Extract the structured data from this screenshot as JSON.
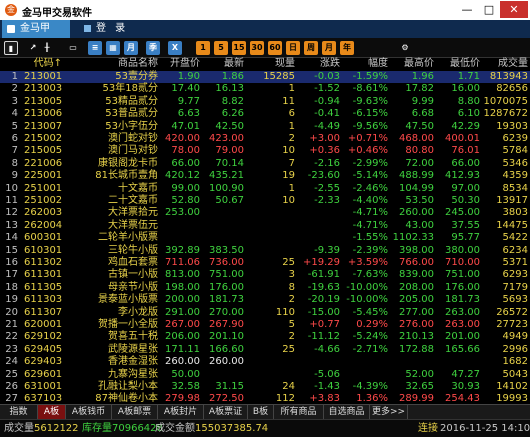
{
  "app": {
    "title": "金马甲交易软件",
    "icon": "金"
  },
  "window": {
    "min": "—",
    "max": "□",
    "close": "✕"
  },
  "tabs": {
    "active_label": "金马甲",
    "login_label": "登 录"
  },
  "toolbar": {
    "buttons": [
      {
        "name": "bar-chart-icon",
        "glyph": "▮",
        "style": "sel"
      },
      {
        "name": "line-chart-icon",
        "glyph": "↗",
        "style": "plain"
      },
      {
        "name": "kline-icon",
        "glyph": "╫",
        "style": "plain"
      },
      {
        "name": "window-icon",
        "glyph": "▭",
        "style": "plain"
      },
      {
        "name": "list-icon",
        "glyph": "≡",
        "style": "blue"
      },
      {
        "name": "table-icon",
        "glyph": "▦",
        "style": "blue"
      },
      {
        "name": "month-icon",
        "glyph": "月",
        "style": "blue"
      },
      {
        "name": "season-icon",
        "glyph": "季",
        "style": "blue"
      },
      {
        "name": "x-icon",
        "glyph": "X",
        "style": "blue"
      },
      {
        "name": "period-1-icon",
        "glyph": "1",
        "style": "orange"
      },
      {
        "name": "period-5-icon",
        "glyph": "5",
        "style": "orange"
      },
      {
        "name": "period-15-icon",
        "glyph": "15",
        "style": "orange"
      },
      {
        "name": "period-30-icon",
        "glyph": "30",
        "style": "orange"
      },
      {
        "name": "period-60-icon",
        "glyph": "60",
        "style": "orange"
      },
      {
        "name": "day-icon",
        "glyph": "日",
        "style": "orange"
      },
      {
        "name": "week-icon",
        "glyph": "周",
        "style": "orange"
      },
      {
        "name": "month2-icon",
        "glyph": "月",
        "style": "orange"
      },
      {
        "name": "year-icon",
        "glyph": "年",
        "style": "orange"
      },
      {
        "name": "gear-icon",
        "glyph": "⚙",
        "style": "plain"
      }
    ]
  },
  "columns": {
    "code": "代码↑",
    "name": "商品名称",
    "open": "开盘价",
    "last": "最新",
    "volume": "现量",
    "change": "涨跌",
    "pct": "幅度",
    "high": "最高价",
    "low": "最低价",
    "amount": "成交量"
  },
  "rows": [
    {
      "i": "1",
      "code": "213001",
      "name": "53壹分券",
      "open": "1.90",
      "last": "1.86",
      "vol": "15285",
      "chg": "-0.03",
      "pct": "-1.59%",
      "high": "1.96",
      "low": "1.71",
      "amt": "813943",
      "s": "dn",
      "sel": true
    },
    {
      "i": "2",
      "code": "213003",
      "name": "53年18贰分",
      "open": "17.40",
      "last": "16.13",
      "vol": "1",
      "chg": "-1.52",
      "pct": "-8.61%",
      "high": "17.82",
      "low": "16.00",
      "amt": "82656",
      "s": "dn"
    },
    {
      "i": "3",
      "code": "213005",
      "name": "53精品贰分",
      "open": "9.77",
      "last": "8.82",
      "vol": "11",
      "chg": "-0.94",
      "pct": "-9.63%",
      "high": "9.99",
      "low": "8.80",
      "amt": "1070075",
      "s": "dn"
    },
    {
      "i": "4",
      "code": "213006",
      "name": "53普品贰分",
      "open": "6.63",
      "last": "6.26",
      "vol": "6",
      "chg": "-0.41",
      "pct": "-6.15%",
      "high": "6.68",
      "low": "6.10",
      "amt": "1287672",
      "s": "dn"
    },
    {
      "i": "5",
      "code": "213007",
      "name": "53小字伍分",
      "open": "47.01",
      "last": "42.50",
      "vol": "1",
      "chg": "-4.49",
      "pct": "-9.56%",
      "high": "47.50",
      "low": "42.29",
      "amt": "19303",
      "s": "dn"
    },
    {
      "i": "6",
      "code": "215002",
      "name": "澳门蛇对钞",
      "open": "420.00",
      "last": "423.00",
      "vol": "2",
      "chg": "+3.00",
      "pct": "+0.71%",
      "high": "468.00",
      "low": "400.01",
      "amt": "6239",
      "s": "up"
    },
    {
      "i": "7",
      "code": "215005",
      "name": "澳门马对钞",
      "open": "78.00",
      "last": "79.00",
      "vol": "10",
      "chg": "+0.36",
      "pct": "+0.46%",
      "high": "80.80",
      "low": "76.01",
      "amt": "5784",
      "s": "up"
    },
    {
      "i": "8",
      "code": "221006",
      "name": "康银阁龙卡币",
      "open": "66.00",
      "last": "70.14",
      "vol": "7",
      "chg": "-2.16",
      "pct": "-2.99%",
      "high": "72.00",
      "low": "66.00",
      "amt": "5346",
      "s": "dn"
    },
    {
      "i": "9",
      "code": "225001",
      "name": "81长城币壹角",
      "open": "420.12",
      "last": "435.21",
      "vol": "19",
      "chg": "-23.60",
      "pct": "-5.14%",
      "high": "488.99",
      "low": "412.93",
      "amt": "4359",
      "s": "dn"
    },
    {
      "i": "10",
      "code": "251001",
      "name": "十文嘉币",
      "open": "99.00",
      "last": "100.90",
      "vol": "1",
      "chg": "-2.55",
      "pct": "-2.46%",
      "high": "104.99",
      "low": "97.00",
      "amt": "8534",
      "s": "dn"
    },
    {
      "i": "11",
      "code": "251002",
      "name": "二十文嘉币",
      "open": "52.80",
      "last": "50.67",
      "vol": "10",
      "chg": "-2.33",
      "pct": "-4.40%",
      "high": "53.50",
      "low": "50.30",
      "amt": "13917",
      "s": "dn"
    },
    {
      "i": "12",
      "code": "262003",
      "name": "大洋票拾元",
      "open": "253.00",
      "last": "",
      "vol": "",
      "chg": "",
      "pct": "-4.71%",
      "high": "260.00",
      "low": "245.00",
      "amt": "3803",
      "s": "dn"
    },
    {
      "i": "13",
      "code": "262004",
      "name": "大洋票伍元",
      "open": "",
      "last": "",
      "vol": "",
      "chg": "",
      "pct": "-4.71%",
      "high": "43.00",
      "low": "37.55",
      "amt": "14475",
      "s": "dn"
    },
    {
      "i": "14",
      "code": "600301",
      "name": "二轮羊小版票",
      "open": "",
      "last": "",
      "vol": "",
      "chg": "",
      "pct": "-1.55%",
      "high": "1102.33",
      "low": "95.77",
      "amt": "5422",
      "s": "dn"
    },
    {
      "i": "15",
      "code": "610301",
      "name": "三轮牛小版",
      "open": "392.89",
      "last": "383.50",
      "vol": "",
      "chg": "-9.39",
      "pct": "-2.39%",
      "high": "398.00",
      "low": "380.00",
      "amt": "6234",
      "s": "dn"
    },
    {
      "i": "16",
      "code": "611302",
      "name": "鸡血石套票",
      "open": "711.06",
      "last": "736.00",
      "vol": "25",
      "chg": "+19.29",
      "pct": "+3.59%",
      "high": "766.00",
      "low": "710.00",
      "amt": "5371",
      "s": "up"
    },
    {
      "i": "17",
      "code": "611301",
      "name": "古镇一小版",
      "open": "813.00",
      "last": "751.00",
      "vol": "3",
      "chg": "-61.91",
      "pct": "-7.63%",
      "high": "839.00",
      "low": "751.00",
      "amt": "6293",
      "s": "dn"
    },
    {
      "i": "18",
      "code": "611305",
      "name": "母亲节小版",
      "open": "198.00",
      "last": "176.00",
      "vol": "8",
      "chg": "-19.63",
      "pct": "-10.00%",
      "high": "208.00",
      "low": "176.00",
      "amt": "7179",
      "s": "dn"
    },
    {
      "i": "19",
      "code": "611303",
      "name": "景泰蓝小版票",
      "open": "200.00",
      "last": "181.73",
      "vol": "2",
      "chg": "-20.19",
      "pct": "-10.00%",
      "high": "205.00",
      "low": "181.73",
      "amt": "5693",
      "s": "dn"
    },
    {
      "i": "20",
      "code": "611307",
      "name": "李小龙版",
      "open": "291.00",
      "last": "270.00",
      "vol": "110",
      "chg": "-15.00",
      "pct": "-5.45%",
      "high": "277.00",
      "low": "263.00",
      "amt": "26572",
      "s": "dn"
    },
    {
      "i": "21",
      "code": "620001",
      "name": "贺播一小全版",
      "open": "267.00",
      "last": "267.90",
      "vol": "5",
      "chg": "+0.77",
      "pct": "0.29%",
      "high": "276.00",
      "low": "263.00",
      "amt": "27723",
      "s": "up"
    },
    {
      "i": "22",
      "code": "629102",
      "name": "贺喜五十税",
      "open": "206.00",
      "last": "201.10",
      "vol": "2",
      "chg": "-11.12",
      "pct": "-5.24%",
      "high": "210.13",
      "low": "201.00",
      "amt": "4949",
      "s": "dn"
    },
    {
      "i": "23",
      "code": "629405",
      "name": "武陵源星张",
      "open": "171.11",
      "last": "166.60",
      "vol": "25",
      "chg": "-4.66",
      "pct": "-2.71%",
      "high": "172.88",
      "low": "165.66",
      "amt": "2996",
      "s": "dn"
    },
    {
      "i": "24",
      "code": "629403",
      "name": "香港金湿张",
      "open": "260.00",
      "last": "260.00",
      "vol": "",
      "chg": "",
      "pct": "",
      "high": "",
      "low": "",
      "amt": "1682",
      "s": "eq"
    },
    {
      "i": "25",
      "code": "629601",
      "name": "九寨沟星张",
      "open": "50.00",
      "last": "",
      "vol": "",
      "chg": "-5.06",
      "pct": "",
      "high": "52.00",
      "low": "47.27",
      "amt": "5043",
      "s": "dn"
    },
    {
      "i": "26",
      "code": "631001",
      "name": "孔融让梨小本",
      "open": "32.58",
      "last": "31.15",
      "vol": "24",
      "chg": "-1.43",
      "pct": "-4.39%",
      "high": "32.65",
      "low": "30.93",
      "amt": "14102",
      "s": "dn"
    },
    {
      "i": "27",
      "code": "637103",
      "name": "87神仙卷小本",
      "open": "279.98",
      "last": "272.50",
      "vol": "112",
      "chg": "+3.83",
      "pct": "1.36%",
      "high": "289.99",
      "low": "254.43",
      "amt": "19993",
      "s": "up"
    }
  ],
  "bottom_tabs": [
    "指数",
    "A板",
    "A板钱币",
    "A板邮票",
    "A板封片",
    "A板票证",
    "B板",
    "所有商品",
    "自选商品",
    "更多>>"
  ],
  "status": {
    "vol_label": "成交量",
    "vol_value": "5612122",
    "stock_label": "库存量",
    "stock_value": "70966428",
    "amt_label": "成交金额",
    "amt_value": "155037385.74",
    "conn": "连接",
    "time": "2016-11-25 14:10"
  },
  "colors": {
    "up": "#ff4a4a",
    "down": "#3fd23f",
    "accent": "#e8d24a",
    "header_bg": "#0f2a4e",
    "tab_active": "#3a88c6"
  }
}
